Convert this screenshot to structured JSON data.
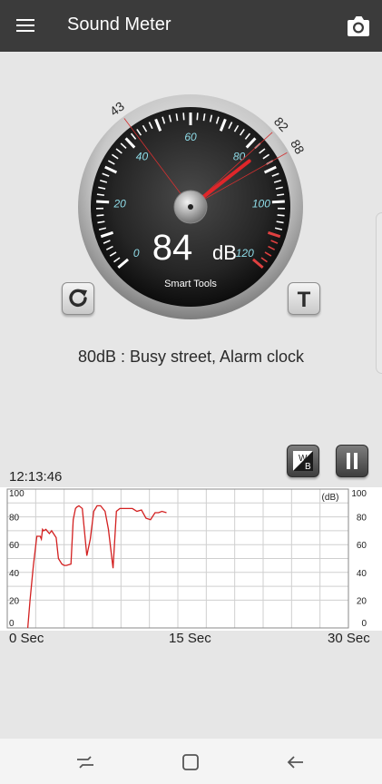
{
  "app_bar": {
    "title": "Sound Meter",
    "menu_icon": "hamburger-menu-icon",
    "camera_icon": "camera-icon"
  },
  "gauge": {
    "current_db": "84",
    "unit": "dB",
    "brand": "Smart Tools",
    "value": 84,
    "min_marker": "43",
    "avg_marker": "82",
    "max_marker": "88",
    "scale_labels": [
      "0",
      "20",
      "40",
      "60",
      "80",
      "100",
      "120"
    ],
    "scale_min": 0,
    "scale_max": 120
  },
  "controls": {
    "reset_icon": "refresh-icon",
    "t_label": "T"
  },
  "status_text": "80dB : Busy street, Alarm clock",
  "graph": {
    "timestamp": "12:13:46",
    "unit_label": "(dB)",
    "y_ticks_left": [
      "100",
      "80",
      "60",
      "40",
      "20",
      "0"
    ],
    "y_ticks_right": [
      "100",
      "80",
      "60",
      "40",
      "20",
      "0"
    ],
    "x_labels": [
      "0 Sec",
      "15 Sec",
      "30 Sec"
    ],
    "wb_top": "W",
    "wb_bottom": "B",
    "pause_icon": "pause-icon"
  },
  "chart_data": {
    "type": "line",
    "xlabel": "",
    "ylabel": "(dB)",
    "xlim": [
      0,
      30
    ],
    "ylim": [
      0,
      100
    ],
    "grid": true,
    "series": [
      {
        "color": "#d32020",
        "x": [
          1.8,
          2.0,
          2.3,
          2.6,
          2.9,
          3.0,
          3.1,
          3.2,
          3.4,
          3.7,
          3.9,
          4.3,
          4.5,
          4.8,
          5.0,
          5.2,
          5.6,
          5.8,
          6.0,
          6.1,
          6.3,
          6.6,
          7.0,
          7.3,
          7.6,
          7.9,
          8.2,
          8.6,
          8.9,
          9.3,
          9.6,
          9.9,
          10.2,
          10.4,
          10.7,
          11.0,
          11.4,
          11.8,
          12.2,
          12.6,
          13.0,
          13.3,
          13.6,
          14.0
        ],
        "y": [
          0,
          20,
          45,
          66,
          66,
          64,
          71,
          70,
          71,
          68,
          70,
          65,
          50,
          46,
          45,
          45,
          46,
          78,
          86,
          87,
          88,
          86,
          52,
          64,
          84,
          88,
          88,
          84,
          71,
          43,
          84,
          86,
          86,
          86,
          86,
          86,
          84,
          85,
          79,
          78,
          83,
          83,
          84,
          83
        ]
      }
    ]
  }
}
